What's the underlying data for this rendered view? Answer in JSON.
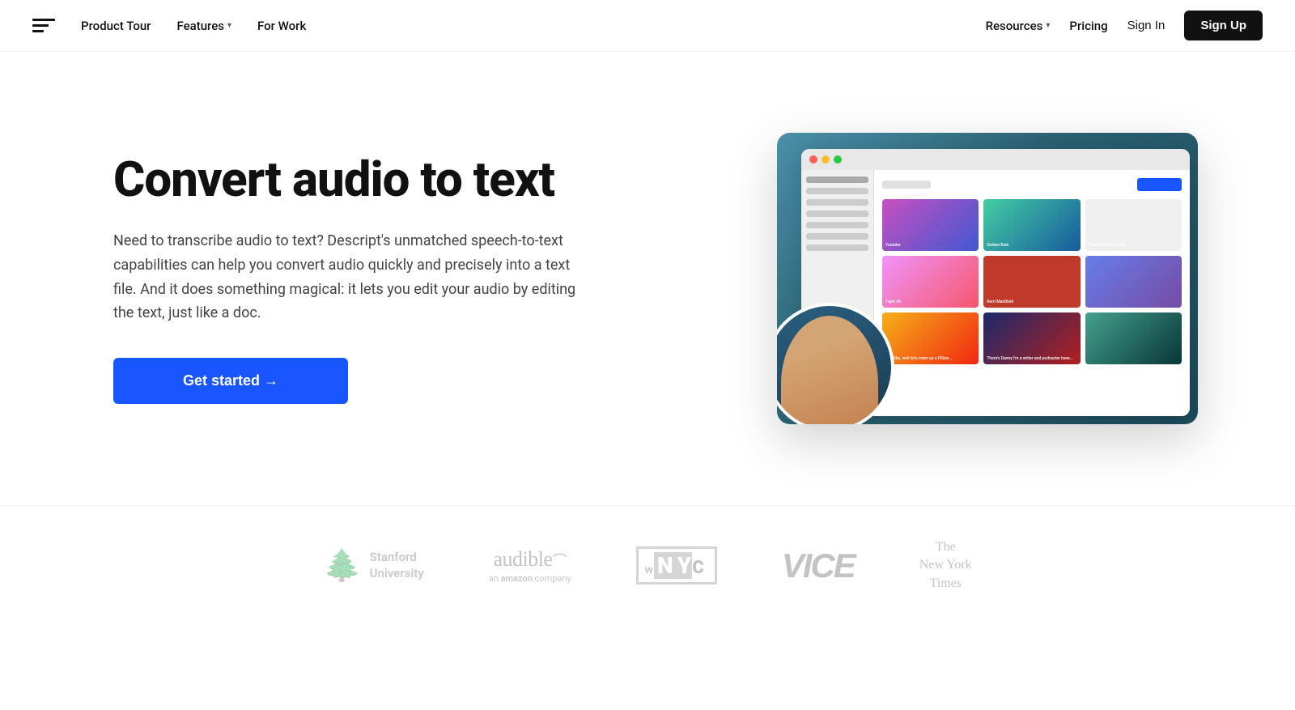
{
  "nav": {
    "logo_icon": "menu-icon",
    "links": [
      {
        "label": "Product Tour",
        "has_dropdown": false
      },
      {
        "label": "Features",
        "has_dropdown": true
      },
      {
        "label": "For Work",
        "has_dropdown": false
      }
    ],
    "right_links": [
      {
        "label": "Resources",
        "has_dropdown": true
      },
      {
        "label": "Pricing",
        "has_dropdown": false
      },
      {
        "label": "Sign In",
        "has_dropdown": false
      }
    ],
    "cta_label": "Sign Up"
  },
  "hero": {
    "title": "Convert audio to text",
    "description": "Need to transcribe audio to text? Descript's unmatched speech-to-text capabilities can help you convert audio quickly and precisely into a text file. And it does something magical: it lets you edit your audio by editing the text, just like a doc.",
    "cta_label": "Get started →"
  },
  "logos": [
    {
      "name": "Stanford University",
      "type": "stanford"
    },
    {
      "name": "audible",
      "type": "audible"
    },
    {
      "name": "WNYC",
      "type": "wnyc"
    },
    {
      "name": "VICE",
      "type": "vice"
    },
    {
      "name": "The New York Times",
      "type": "nyt"
    }
  ]
}
